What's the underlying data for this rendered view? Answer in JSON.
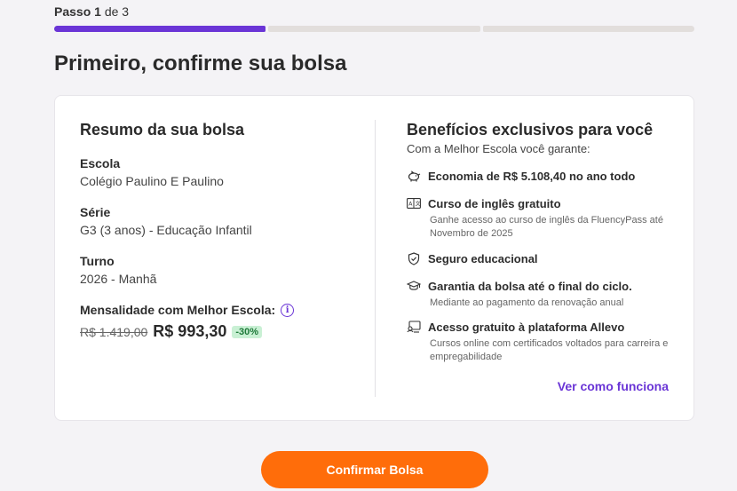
{
  "progress": {
    "step_word": "Passo",
    "step_current": "1",
    "step_of": "de 3",
    "total_steps": 3,
    "current_step": 1
  },
  "page": {
    "title": "Primeiro, confirme sua bolsa"
  },
  "summary": {
    "title": "Resumo da sua bolsa",
    "school_label": "Escola",
    "school_value": "Colégio Paulino E Paulino",
    "grade_label": "Série",
    "grade_value": "G3 (3 anos) - Educação Infantil",
    "shift_label": "Turno",
    "shift_value": "2026 - Manhã",
    "price_label": "Mensalidade com Melhor Escola:",
    "old_price": "R$ 1.419,00",
    "new_price": "R$ 993,30",
    "discount": "-30%",
    "info_icon": "i"
  },
  "benefits": {
    "title": "Benefícios exclusivos para você",
    "subtitle": "Com a Melhor Escola você garante:",
    "items": [
      {
        "icon": "piggy-bank-icon",
        "title": "Economia de R$ 5.108,40 no ano todo",
        "desc": ""
      },
      {
        "icon": "translate-icon",
        "title": "Curso de inglês gratuito",
        "desc": "Ganhe acesso ao curso de inglês da FluencyPass até Novembro de 2025"
      },
      {
        "icon": "shield-icon",
        "title": "Seguro educacional",
        "desc": ""
      },
      {
        "icon": "graduation-cap-icon",
        "title": "Garantia da bolsa até o final do ciclo.",
        "desc": "Mediante ao pagamento da renovação anual"
      },
      {
        "icon": "online-course-icon",
        "title": "Acesso gratuito à plataforma Allevo",
        "desc": "Cursos online com certificados voltados para carreira e empregabilidade"
      }
    ],
    "link": "Ver como funciona"
  },
  "cta": {
    "label": "Confirmar Bolsa"
  },
  "colors": {
    "accent": "#6a35d6",
    "cta": "#ff6d0a",
    "discount_bg": "#c9f0d4"
  }
}
